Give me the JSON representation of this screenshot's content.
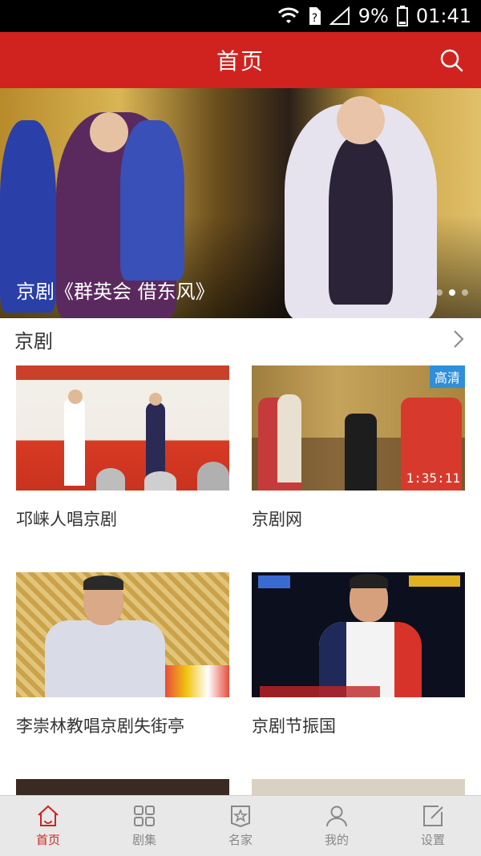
{
  "status_bar": {
    "battery": "9%",
    "time": "01:41"
  },
  "header": {
    "title": "首页",
    "search_icon": "search-icon"
  },
  "banner": {
    "caption": "京剧《群英会 借东风》",
    "active_dot": 2,
    "dot_count": 3
  },
  "section": {
    "title": "京剧"
  },
  "cards": [
    {
      "title": "邛崃人唱京剧"
    },
    {
      "title": "京剧网",
      "badge": "高清",
      "duration": "1:35:11"
    },
    {
      "title": "李崇林教唱京剧失街亭"
    },
    {
      "title": "京剧节振国"
    }
  ],
  "nav": [
    {
      "label": "首页",
      "icon": "home-icon",
      "active": true
    },
    {
      "label": "剧集",
      "icon": "grid-icon"
    },
    {
      "label": "名家",
      "icon": "star-badge-icon"
    },
    {
      "label": "我的",
      "icon": "user-icon"
    },
    {
      "label": "设置",
      "icon": "edit-icon"
    }
  ],
  "colors": {
    "brand": "#d0231f",
    "nav_bg": "#e8e8e8"
  }
}
